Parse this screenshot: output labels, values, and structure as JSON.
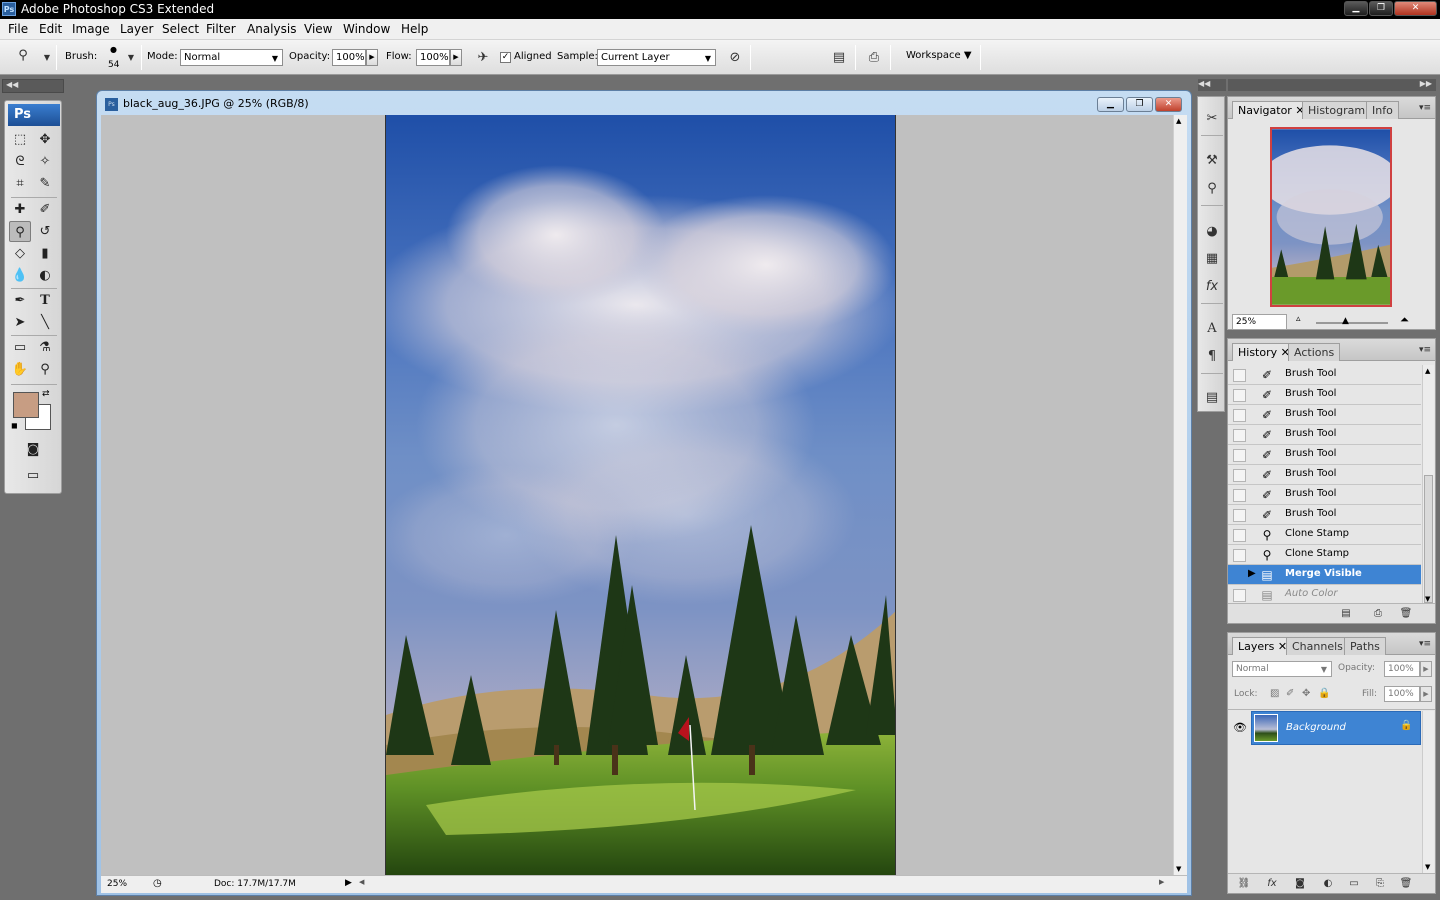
{
  "window": {
    "title": "Adobe Photoshop CS3 Extended",
    "app_icon": "Ps"
  },
  "menu": [
    "File",
    "Edit",
    "Image",
    "Layer",
    "Select",
    "Filter",
    "Analysis",
    "View",
    "Window",
    "Help"
  ],
  "options": {
    "brush_label": "Brush:",
    "brush_size": "54",
    "mode_label": "Mode:",
    "mode_value": "Normal",
    "opacity_label": "Opacity:",
    "opacity_value": "100%",
    "flow_label": "Flow:",
    "flow_value": "100%",
    "aligned_label": "Aligned",
    "aligned_checked": true,
    "sample_label": "Sample:",
    "sample_value": "Current Layer",
    "workspace_label": "Workspace"
  },
  "toolbox": {
    "logo": "Ps",
    "foreground_color": "#c79d83",
    "background_color": "#ffffff"
  },
  "document": {
    "title": "black_aug_36.JPG @ 25% (RGB/8)",
    "zoom": "25%",
    "doc_info": "Doc: 17.7M/17.7M"
  },
  "navigator": {
    "tabs": [
      "Navigator",
      "Histogram",
      "Info"
    ],
    "zoom": "25%"
  },
  "history": {
    "tabs": [
      "History",
      "Actions"
    ],
    "items": [
      {
        "label": "Brush Tool",
        "icon": "brush-icon",
        "state": "normal"
      },
      {
        "label": "Brush Tool",
        "icon": "brush-icon",
        "state": "normal"
      },
      {
        "label": "Brush Tool",
        "icon": "brush-icon",
        "state": "normal"
      },
      {
        "label": "Brush Tool",
        "icon": "brush-icon",
        "state": "normal"
      },
      {
        "label": "Brush Tool",
        "icon": "brush-icon",
        "state": "normal"
      },
      {
        "label": "Brush Tool",
        "icon": "brush-icon",
        "state": "normal"
      },
      {
        "label": "Brush Tool",
        "icon": "brush-icon",
        "state": "normal"
      },
      {
        "label": "Brush Tool",
        "icon": "brush-icon",
        "state": "normal"
      },
      {
        "label": "Clone Stamp",
        "icon": "stamp-icon",
        "state": "normal"
      },
      {
        "label": "Clone Stamp",
        "icon": "stamp-icon",
        "state": "normal"
      },
      {
        "label": "Merge Visible",
        "icon": "layers-icon",
        "state": "selected"
      },
      {
        "label": "Auto Color",
        "icon": "layers-icon",
        "state": "future"
      }
    ]
  },
  "layers": {
    "tabs": [
      "Layers",
      "Channels",
      "Paths"
    ],
    "blend_mode": "Normal",
    "opacity_label": "Opacity:",
    "opacity_value": "100%",
    "lock_label": "Lock:",
    "fill_label": "Fill:",
    "fill_value": "100%",
    "items": [
      {
        "name": "Background"
      }
    ]
  }
}
